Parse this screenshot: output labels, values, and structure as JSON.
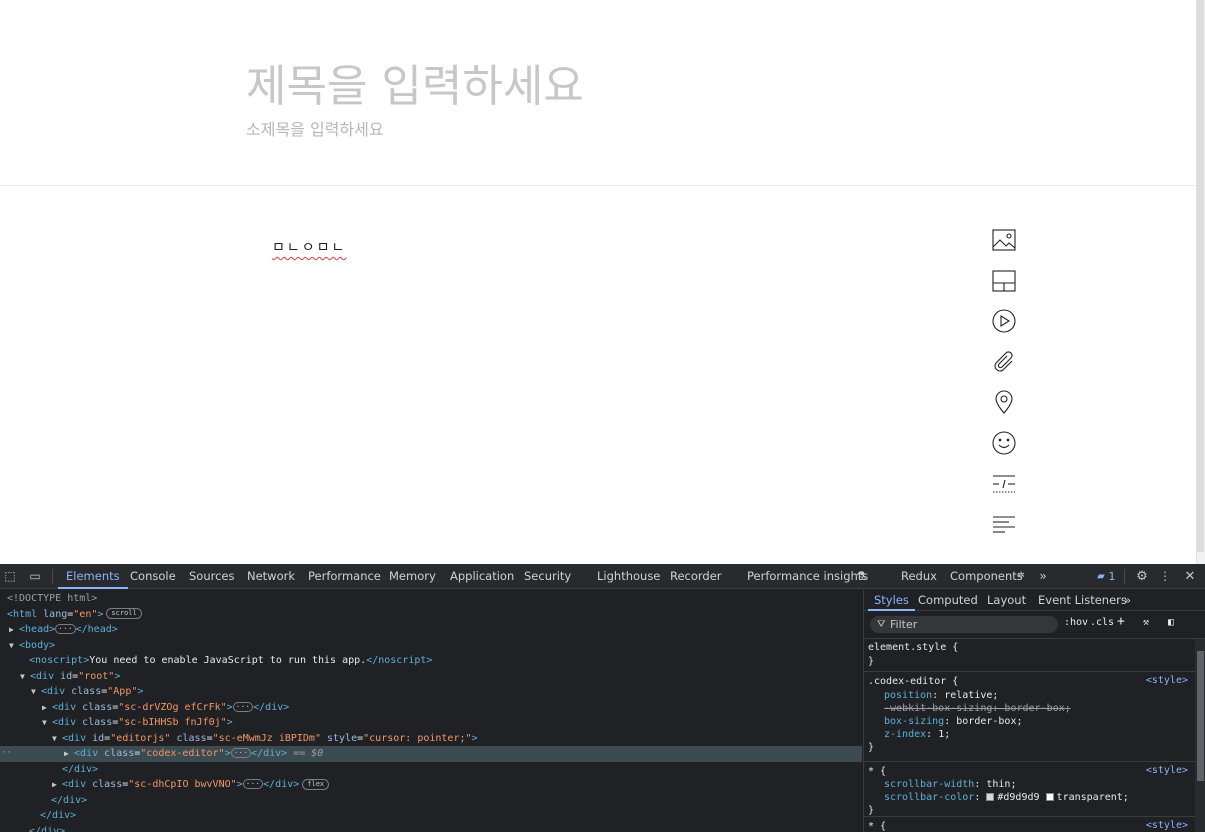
{
  "page": {
    "title_placeholder": "제목을 입력하세요",
    "subtitle_placeholder": "소제목을 입력하세요",
    "editor_text": "ㅁㄴㅇㅁㄴ",
    "toolbar": [
      {
        "name": "image-tool",
        "icon": "image-icon"
      },
      {
        "name": "layout-tool",
        "icon": "layout-icon"
      },
      {
        "name": "video-tool",
        "icon": "play-icon"
      },
      {
        "name": "attachment-tool",
        "icon": "paperclip-icon"
      },
      {
        "name": "location-tool",
        "icon": "map-pin-icon"
      },
      {
        "name": "emoji-tool",
        "icon": "smile-icon"
      },
      {
        "name": "divider-tool",
        "icon": "divider-icon"
      },
      {
        "name": "align-tool",
        "icon": "align-left-icon"
      }
    ]
  },
  "devtools": {
    "tabs": [
      "Elements",
      "Console",
      "Sources",
      "Network",
      "Performance",
      "Memory",
      "Application",
      "Security",
      "Lighthouse",
      "Recorder",
      "Performance insights",
      "Redux",
      "Components"
    ],
    "active_tab": "Elements",
    "issues_count": "1",
    "dom": {
      "doctype": "<!DOCTYPE html>",
      "html_open": "<html lang=\"en\">",
      "html_tag": "html",
      "lang_attr": "lang",
      "lang_val": "\"en\"",
      "scroll_badge": "scroll",
      "head": "head",
      "body": "body",
      "noscript_text": "You need to enable JavaScript to run this app.",
      "noscript": "noscript",
      "div": "div",
      "id_attr": "id",
      "class_attr": "class",
      "style_attr": "style",
      "root_id": "\"root\"",
      "app_class": "\"App\"",
      "class1": "\"sc-drVZOg efCrFk\"",
      "class2": "\"sc-bIHHSb fnJf0j\"",
      "editorjs_id": "\"editorjs\"",
      "editorjs_class": "\"sc-eMwmJz iBPIDm\"",
      "editorjs_style": "\"cursor: pointer;\"",
      "codex_class": "\"codex-editor\"",
      "selected_marker": "== $0",
      "class3": "\"sc-dhCpIO bwvVNO\"",
      "flex_badge": "flex"
    },
    "styles": {
      "tabs": [
        "Styles",
        "Computed",
        "Layout",
        "Event Listeners"
      ],
      "active_tab": "Styles",
      "filter_placeholder": "Filter",
      "hov": ":hov",
      "cls": ".cls",
      "element_style": "element.style {",
      "close_brace": "}",
      "codex_selector": ".codex-editor {",
      "src": "<style>",
      "props": {
        "position": "position",
        "position_val": "relative",
        "webkit": "-webkit-box-sizing",
        "webkit_val": "border-box",
        "box_sizing": "box-sizing",
        "box_sizing_val": "border-box",
        "z_index": "z-index",
        "z_index_val": "1"
      },
      "star_selector": "* {",
      "scrollbar_width": "scrollbar-width",
      "scrollbar_width_val": "thin",
      "scrollbar_color": "scrollbar-color",
      "scrollbar_color_val1": "#d9d9d9",
      "scrollbar_color_val2": "transparent",
      "swatch_color1": "#d9d9d9",
      "swatch_color2": "#ffffff"
    }
  }
}
